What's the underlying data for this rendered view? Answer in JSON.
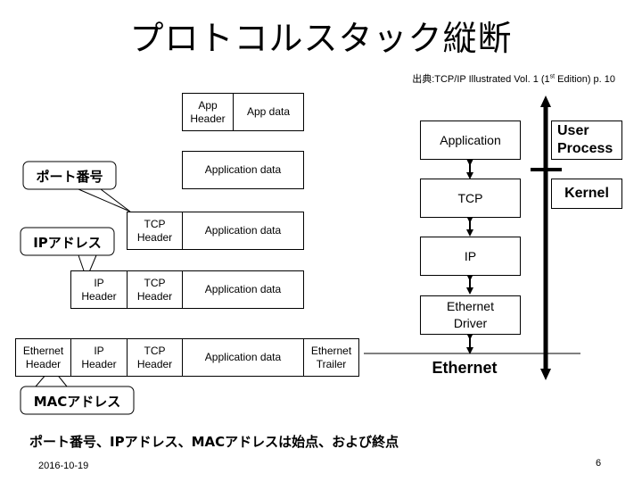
{
  "slide": {
    "title": "プロトコルスタック縦断",
    "source_prefix": "出典:TCP/IP Illustrated Vol. 1 (1",
    "source_sup": "st",
    "source_suffix": " Edition) p. 10",
    "summary": "ポート番号、IPアドレス、MACアドレスは始点、および終点",
    "date": "2016-10-19",
    "page_number": "6"
  },
  "packets": {
    "app_row": {
      "header": "App\nHeader",
      "data": "App data"
    },
    "app_data_row": {
      "data": "Application data"
    },
    "tcp_row": {
      "tcp_header": "TCP\nHeader",
      "data": "Application data"
    },
    "ip_row": {
      "ip_header": "IP\nHeader",
      "tcp_header": "TCP\nHeader",
      "data": "Application data"
    },
    "eth_row": {
      "eth_header": "Ethernet\nHeader",
      "ip_header": "IP\nHeader",
      "tcp_header": "TCP\nHeader",
      "data": "Application data",
      "eth_trailer": "Ethernet\nTrailer"
    }
  },
  "callouts": {
    "port": "ポート番号",
    "ip": "IPアドレス",
    "mac": "MACアドレス"
  },
  "stack": {
    "layers": [
      "Application",
      "TCP",
      "IP",
      "Ethernet\nDriver"
    ],
    "network_label": "Ethernet",
    "user_space_label": "User\nProcess",
    "kernel_label": "Kernel"
  }
}
